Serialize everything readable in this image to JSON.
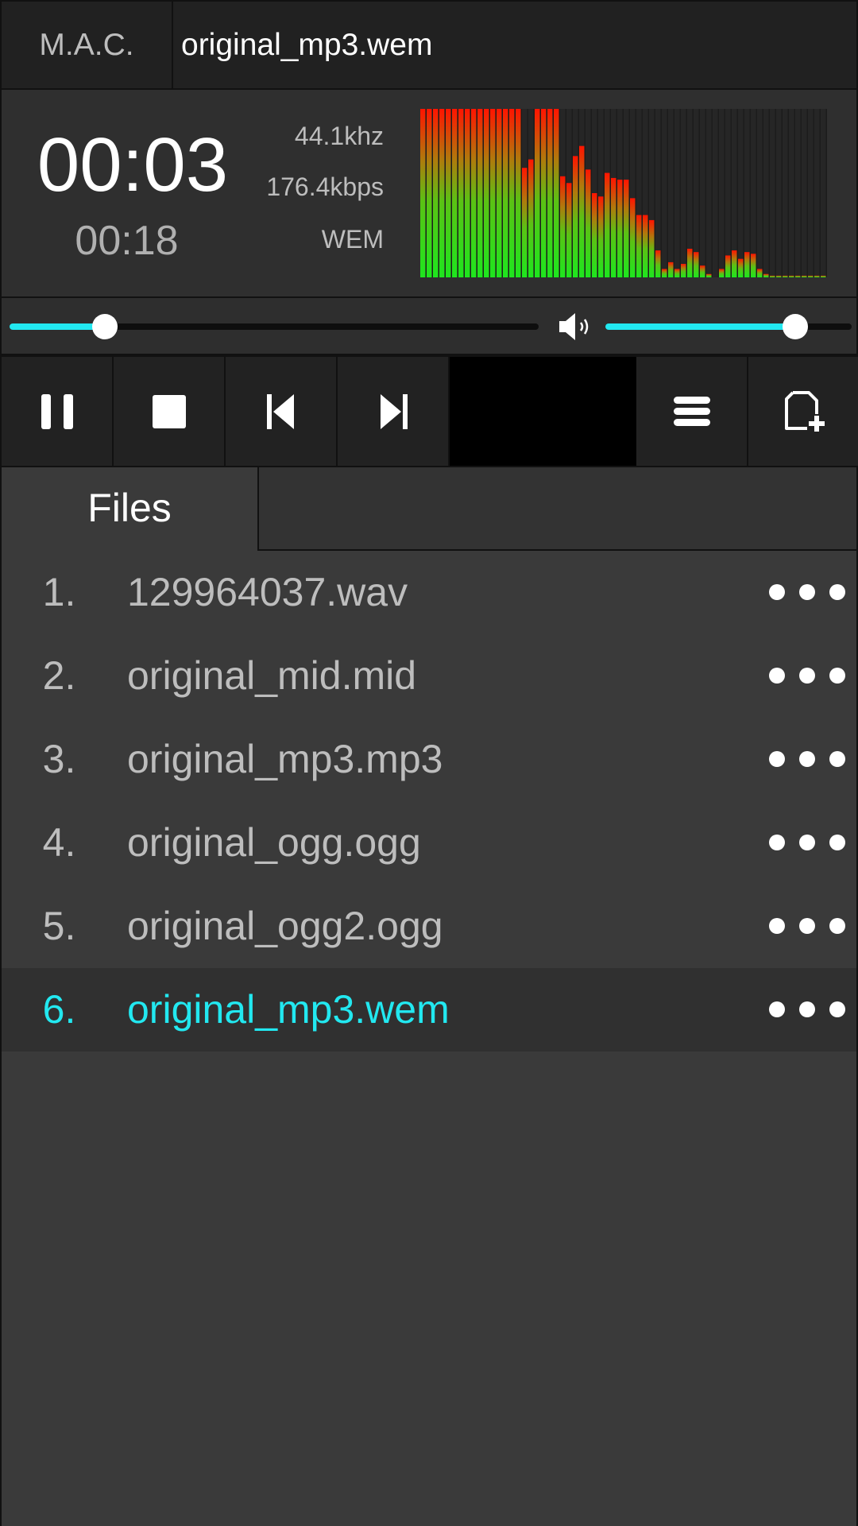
{
  "header": {
    "app_name": "M.A.C.",
    "track_title": "original_mp3.wem"
  },
  "now_playing": {
    "current_time": "00:03",
    "total_time": "00:18",
    "sample_rate": "44.1khz",
    "bitrate": "176.4kbps",
    "format": "WEM",
    "spectrum_levels": [
      1,
      1,
      1,
      1,
      1,
      1,
      1,
      1,
      1,
      1,
      1,
      1,
      1,
      1,
      1,
      1,
      0.65,
      0.7,
      1,
      1,
      1,
      1,
      0.6,
      0.56,
      0.72,
      0.78,
      0.64,
      0.5,
      0.48,
      0.62,
      0.59,
      0.58,
      0.58,
      0.47,
      0.37,
      0.37,
      0.34,
      0.16,
      0.05,
      0.09,
      0.05,
      0.08,
      0.17,
      0.15,
      0.07,
      0.02,
      0,
      0.05,
      0.13,
      0.16,
      0.11,
      0.15,
      0.14,
      0.05,
      0.02,
      0.01,
      0.01,
      0.01,
      0.01,
      0.01,
      0.01,
      0.01,
      0.01,
      0.01
    ]
  },
  "sliders": {
    "seek_fraction": 0.18,
    "volume_fraction": 0.77
  },
  "controls": {
    "icons": [
      "pause-icon",
      "stop-icon",
      "previous-icon",
      "next-icon",
      "playlist-icon",
      "add-file-icon"
    ]
  },
  "tabs": {
    "files_label": "Files"
  },
  "files": [
    {
      "number": "1.",
      "name": "129964037.wav"
    },
    {
      "number": "2.",
      "name": "original_mid.mid"
    },
    {
      "number": "3.",
      "name": "original_mp3.mp3"
    },
    {
      "number": "4.",
      "name": "original_ogg.ogg"
    },
    {
      "number": "5.",
      "name": "original_ogg2.ogg"
    },
    {
      "number": "6.",
      "name": "original_mp3.wem"
    }
  ],
  "active_file_index": 5,
  "colors": {
    "accent": "#22e8f0",
    "spectrum_low": "#1ee61e",
    "spectrum_high": "#ff1400"
  }
}
